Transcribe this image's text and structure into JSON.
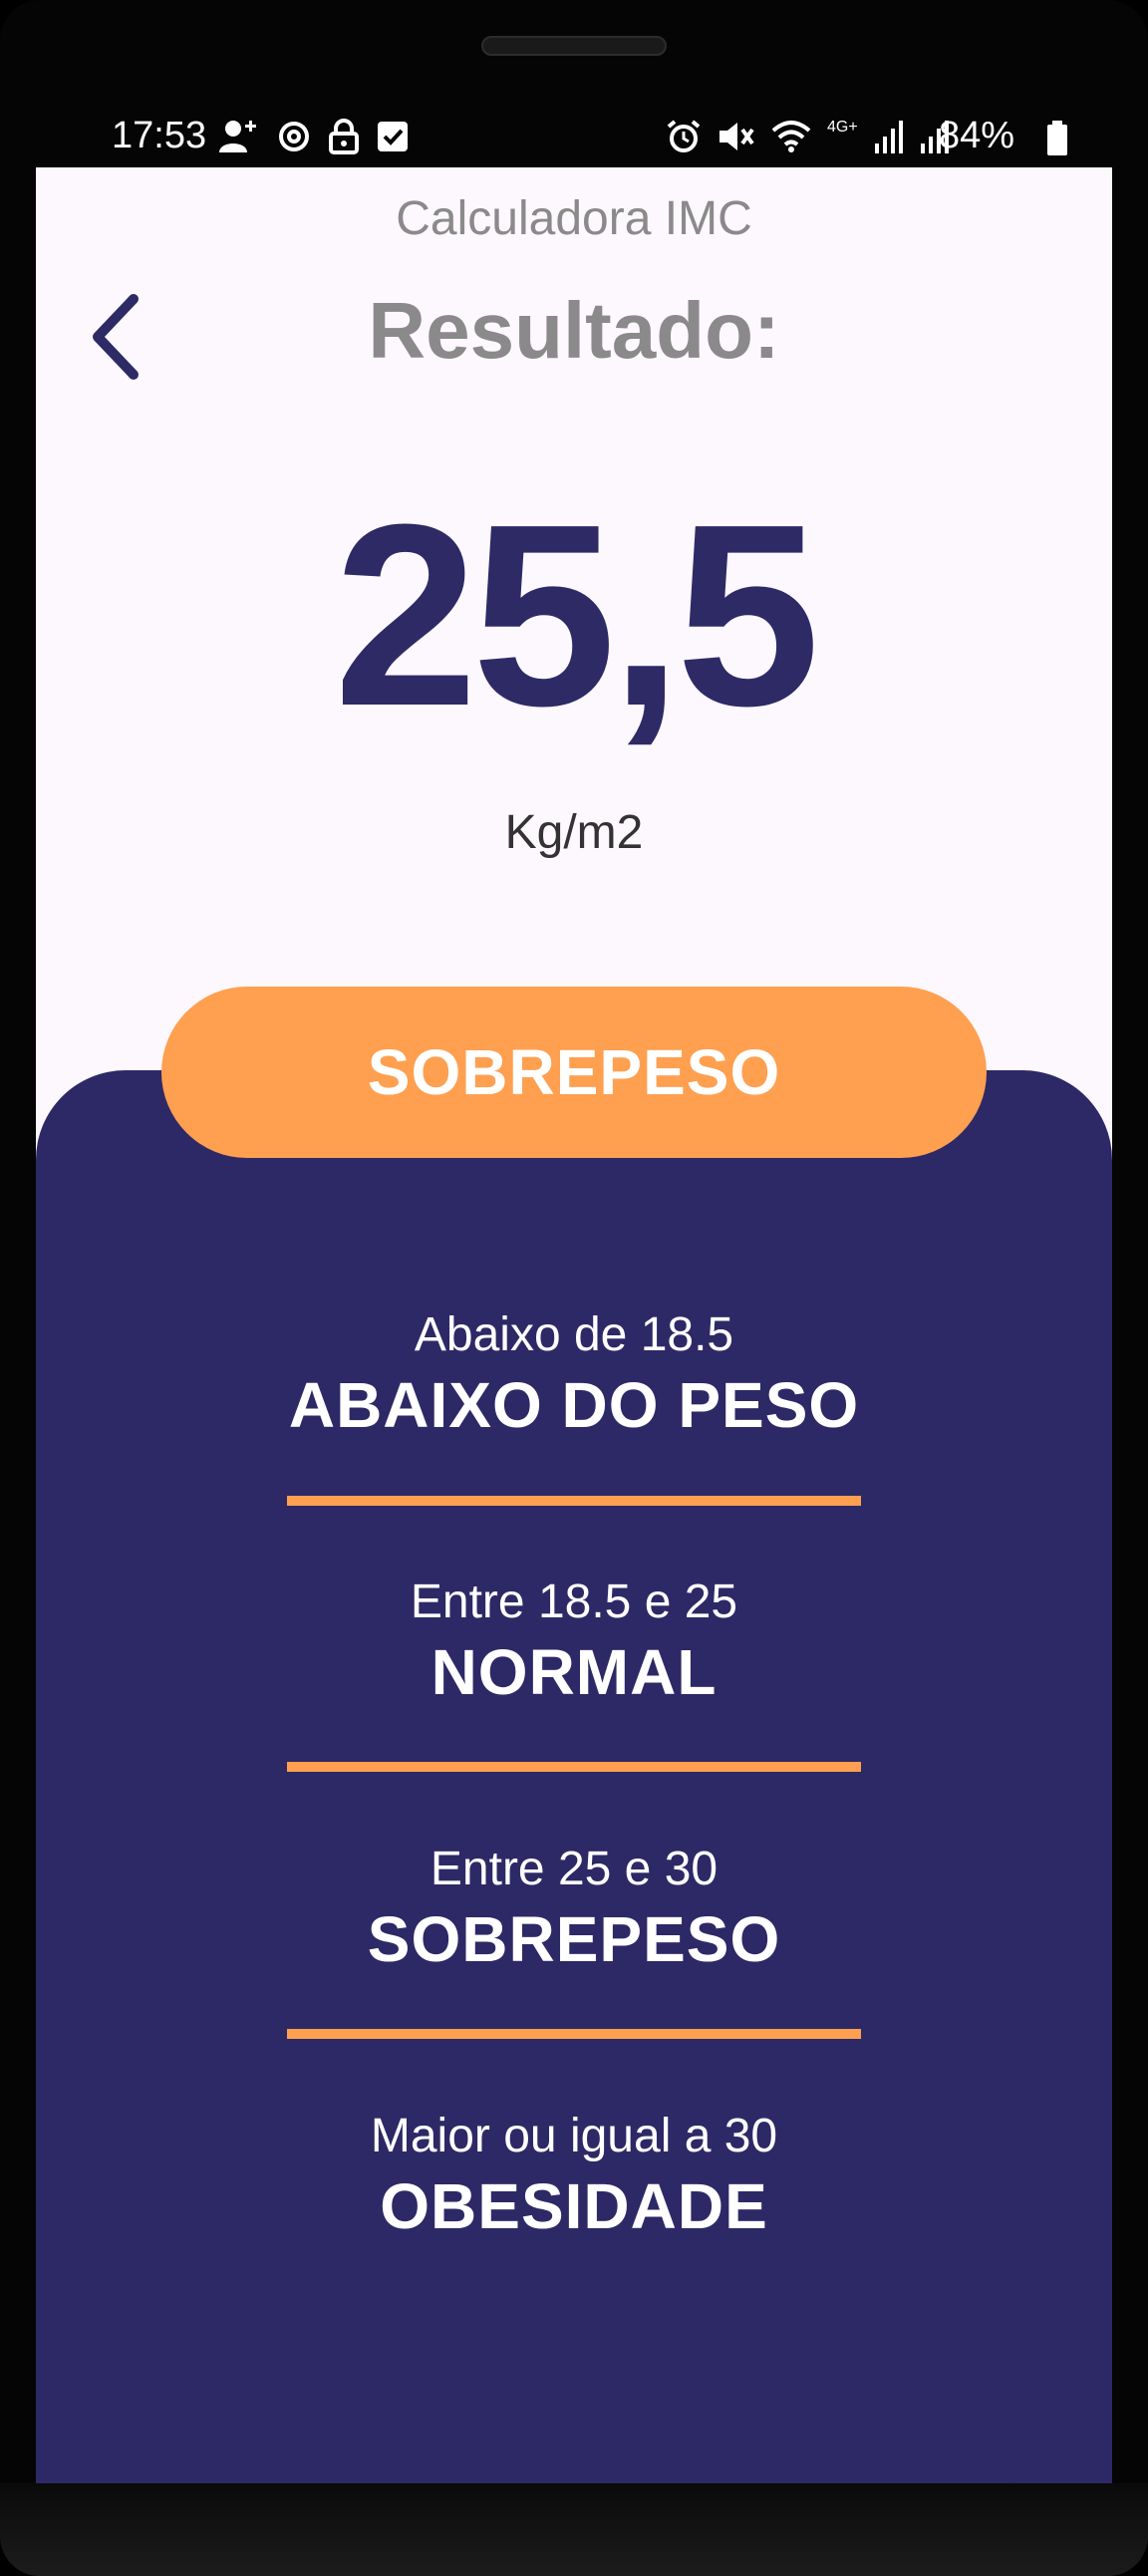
{
  "status_bar": {
    "time": "17:53",
    "battery_percent": "84%",
    "left_icons": [
      "person-add-icon",
      "sync-icon",
      "lock-icon",
      "check-box-icon"
    ],
    "right_icons": [
      "alarm-icon",
      "mute-icon",
      "wifi-icon",
      "signal-icon",
      "signal-icon"
    ],
    "network_label": "4G+"
  },
  "header": {
    "app_title": "Calculadora IMC",
    "back_icon": "chevron-left-icon",
    "heading": "Resultado:"
  },
  "result": {
    "value": "25,5",
    "unit": "Kg/m2",
    "classification": "SOBREPESO"
  },
  "categories": [
    {
      "range": "Abaixo de 18.5",
      "label": "ABAIXO DO PESO"
    },
    {
      "range": "Entre 18.5 e 25",
      "label": "NORMAL"
    },
    {
      "range": "Entre 25 e 30",
      "label": "SOBREPESO"
    },
    {
      "range": "Maior ou igual a 30",
      "label": "OBESIDADE"
    }
  ],
  "colors": {
    "primary": "#2d2966",
    "accent": "#ff9f50",
    "background": "#fdf8fd",
    "muted_text": "#8a8a8a"
  }
}
